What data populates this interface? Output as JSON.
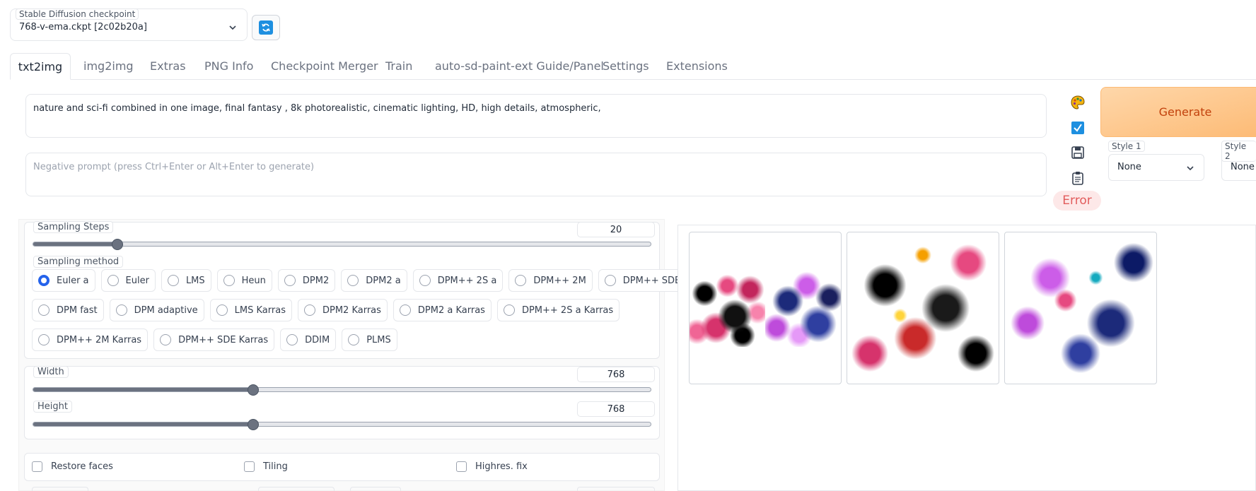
{
  "checkpoint": {
    "label": "Stable Diffusion checkpoint",
    "value": "768-v-ema.ckpt [2c02b20a]"
  },
  "tabs": [
    {
      "label": "txt2img"
    },
    {
      "label": "img2img"
    },
    {
      "label": "Extras"
    },
    {
      "label": "PNG Info"
    },
    {
      "label": "Checkpoint Merger"
    },
    {
      "label": "Train"
    },
    {
      "label": "auto-sd-paint-ext Guide/Panel"
    },
    {
      "label": "Settings"
    },
    {
      "label": "Extensions"
    }
  ],
  "prompt": {
    "value": "nature and sci-fi combined in one image, final fantasy , 8k photorealistic, cinematic lighting, HD, high details, atmospheric,"
  },
  "negative_prompt": {
    "placeholder": "Negative prompt (press Ctrl+Enter or Alt+Enter to generate)"
  },
  "generate": {
    "label": "Generate"
  },
  "error": {
    "label": "Error"
  },
  "styles": [
    {
      "label": "Style 1",
      "value": "None"
    },
    {
      "label": "Style 2",
      "value": "None"
    }
  ],
  "sampling_steps": {
    "label": "Sampling Steps",
    "value": "20",
    "fraction": 0.137
  },
  "sampling_method": {
    "label": "Sampling method",
    "selected": "Euler a",
    "options_row1": [
      "Euler a",
      "Euler",
      "LMS",
      "Heun",
      "DPM2",
      "DPM2 a",
      "DPM++ 2S a",
      "DPM++ 2M",
      "DPM++ SDE"
    ],
    "options_row2": [
      "DPM fast",
      "DPM adaptive",
      "LMS Karras",
      "DPM2 Karras",
      "DPM2 a Karras",
      "DPM++ 2S a Karras"
    ],
    "options_row3": [
      "DPM++ 2M Karras",
      "DPM++ SDE Karras",
      "DDIM",
      "PLMS"
    ]
  },
  "width": {
    "label": "Width",
    "value": "768",
    "fraction": 0.357
  },
  "height": {
    "label": "Height",
    "value": "768",
    "fraction": 0.357
  },
  "checks": {
    "restore_faces": "Restore faces",
    "tiling": "Tiling",
    "highres_fix": "Highres. fix"
  },
  "icons": {
    "palette": "palette-icon",
    "check": "checkbox-icon",
    "save": "save-icon",
    "clipboard": "clipboard-icon",
    "refresh": "refresh-icon"
  },
  "colors": {
    "generate_bg": "#fdba74",
    "generate_text": "#c2410c",
    "error": "#e25c5c",
    "accent": "#2563eb"
  }
}
